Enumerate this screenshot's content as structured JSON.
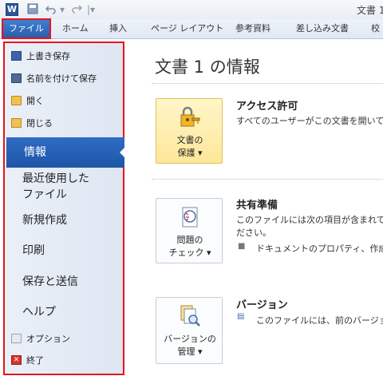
{
  "app": {
    "title": "文書 1",
    "logo_letter": "W"
  },
  "quick_access": {
    "save_icon": "save-icon",
    "undo_icon": "undo-icon",
    "redo_icon": "redo-icon"
  },
  "tabs": {
    "file": "ファイル",
    "items": [
      "ホーム",
      "挿入",
      "ページ レイアウト",
      "参考資料",
      "差し込み文書",
      "校"
    ]
  },
  "backstage_menu": {
    "save": "上書き保存",
    "save_as": "名前を付けて保存",
    "open": "開く",
    "close": "閉じる",
    "info": "情報",
    "recent_line1": "最近使用した",
    "recent_line2": "ファイル",
    "new": "新規作成",
    "print": "印刷",
    "save_send": "保存と送信",
    "help": "ヘルプ",
    "options": "オプション",
    "exit": "終了"
  },
  "info_panel": {
    "title": "文書 1 の情報",
    "permissions": {
      "button_line1": "文書の",
      "button_line2": "保護 ▾",
      "heading": "アクセス許可",
      "text": "すべてのユーザーがこの文書を開いて"
    },
    "prepare": {
      "button_line1": "問題の",
      "button_line2": "チェック ▾",
      "heading": "共有準備",
      "text_line1": "このファイルには次の項目が含まれて",
      "text_line2": "ださい。",
      "bullet": "ドキュメントのプロパティ、作成者"
    },
    "versions": {
      "button_line1": "バージョンの",
      "button_line2": "管理 ▾",
      "heading": "バージョン",
      "text": "このファイルには、前のバージョン"
    }
  },
  "colors": {
    "file_tab": "#2a5ea8",
    "highlight_border": "#e8131c",
    "info_selected": "#1f56a6"
  }
}
